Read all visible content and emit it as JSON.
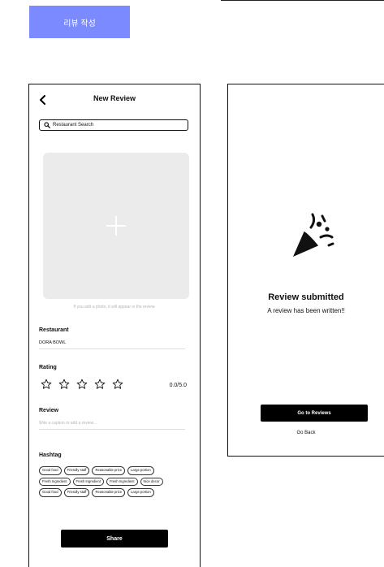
{
  "frame_label": "리뷰 작성",
  "review_screen": {
    "title": "New Review",
    "search_placeholder": "Restaurant Search",
    "photo_hint": "If you add a photo, it will appear in the review.",
    "restaurant_label": "Restaurant",
    "restaurant_value": "DORA BOWL",
    "rating_label": "Rating",
    "rating": 0,
    "rating_max": 5,
    "rating_text": "0.0/5.0",
    "review_label": "Review",
    "review_placeholder": "Wite a caption or add a review...",
    "hashtag_label": "Hashtag",
    "hashtags": [
      [
        "Good food",
        "Friendly staff",
        "Reasonable price",
        "Large portion"
      ],
      [
        "Fresh Ingredient",
        "Fresh Ingredient",
        "Fresh Ingredient",
        "Nice decor"
      ],
      [
        "Good food",
        "Friendly staff",
        "Reasonable price",
        "Large portion"
      ]
    ],
    "share_label": "Share"
  },
  "done_screen": {
    "title": "Review submitted",
    "subtitle": "A review has been written!!",
    "primary_button": "Go to Reviews",
    "secondary_button": "Go Back"
  },
  "icons": {
    "back": "chevron-left-icon",
    "search": "search-icon",
    "add_photo": "plus-icon",
    "star": "star-outline-icon",
    "celebrate": "party-popper-icon"
  }
}
